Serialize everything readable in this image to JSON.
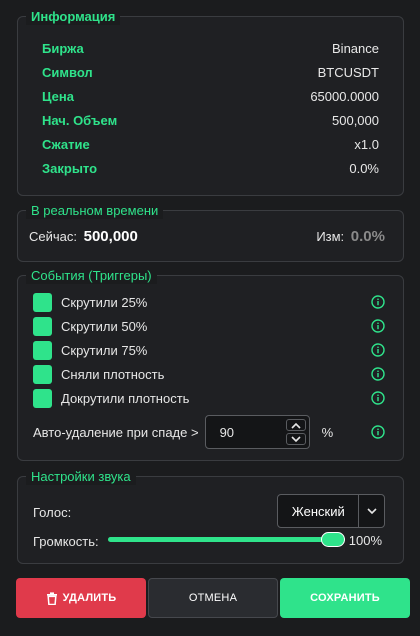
{
  "info": {
    "title": "Информация",
    "rows": [
      {
        "label": "Биржа",
        "value": "Binance"
      },
      {
        "label": "Символ",
        "value": "BTCUSDT"
      },
      {
        "label": "Цена",
        "value": "65000.0000"
      },
      {
        "label": "Нач. Объем",
        "value": "500,000"
      },
      {
        "label": "Сжатие",
        "value": "x1.0"
      },
      {
        "label": "Закрыто",
        "value": "0.0%"
      }
    ]
  },
  "realtime": {
    "title": "В реальном времени",
    "now_label": "Сейчас:",
    "now_value": "500,000",
    "change_label": "Изм:",
    "change_value": "0.0%"
  },
  "events": {
    "title": "События (Триггеры)",
    "triggers": [
      {
        "label": "Скрутили 25%"
      },
      {
        "label": "Скрутили 50%"
      },
      {
        "label": "Скрутили 75%"
      },
      {
        "label": "Сняли плотность"
      },
      {
        "label": "Докрутили плотность"
      }
    ],
    "auto_delete_label": "Авто-удаление при спаде >",
    "auto_delete_value": "90",
    "auto_delete_unit": "%"
  },
  "sound": {
    "title": "Настройки звука",
    "voice_label": "Голос:",
    "voice_value": "Женский",
    "volume_label": "Громкость:",
    "volume_value": "100%",
    "volume_level": 1.0
  },
  "buttons": {
    "delete": "УДАЛИТЬ",
    "cancel": "ОТМЕНА",
    "save": "СОХРАНИТЬ"
  },
  "colors": {
    "accent": "#2fe38b",
    "danger": "#e03a4b",
    "background": "#1b1c1e"
  },
  "icons": {
    "info": "info-circle-icon",
    "trash": "trash-icon",
    "chevron_up": "chevron-up-icon",
    "chevron_down": "chevron-down-icon"
  }
}
